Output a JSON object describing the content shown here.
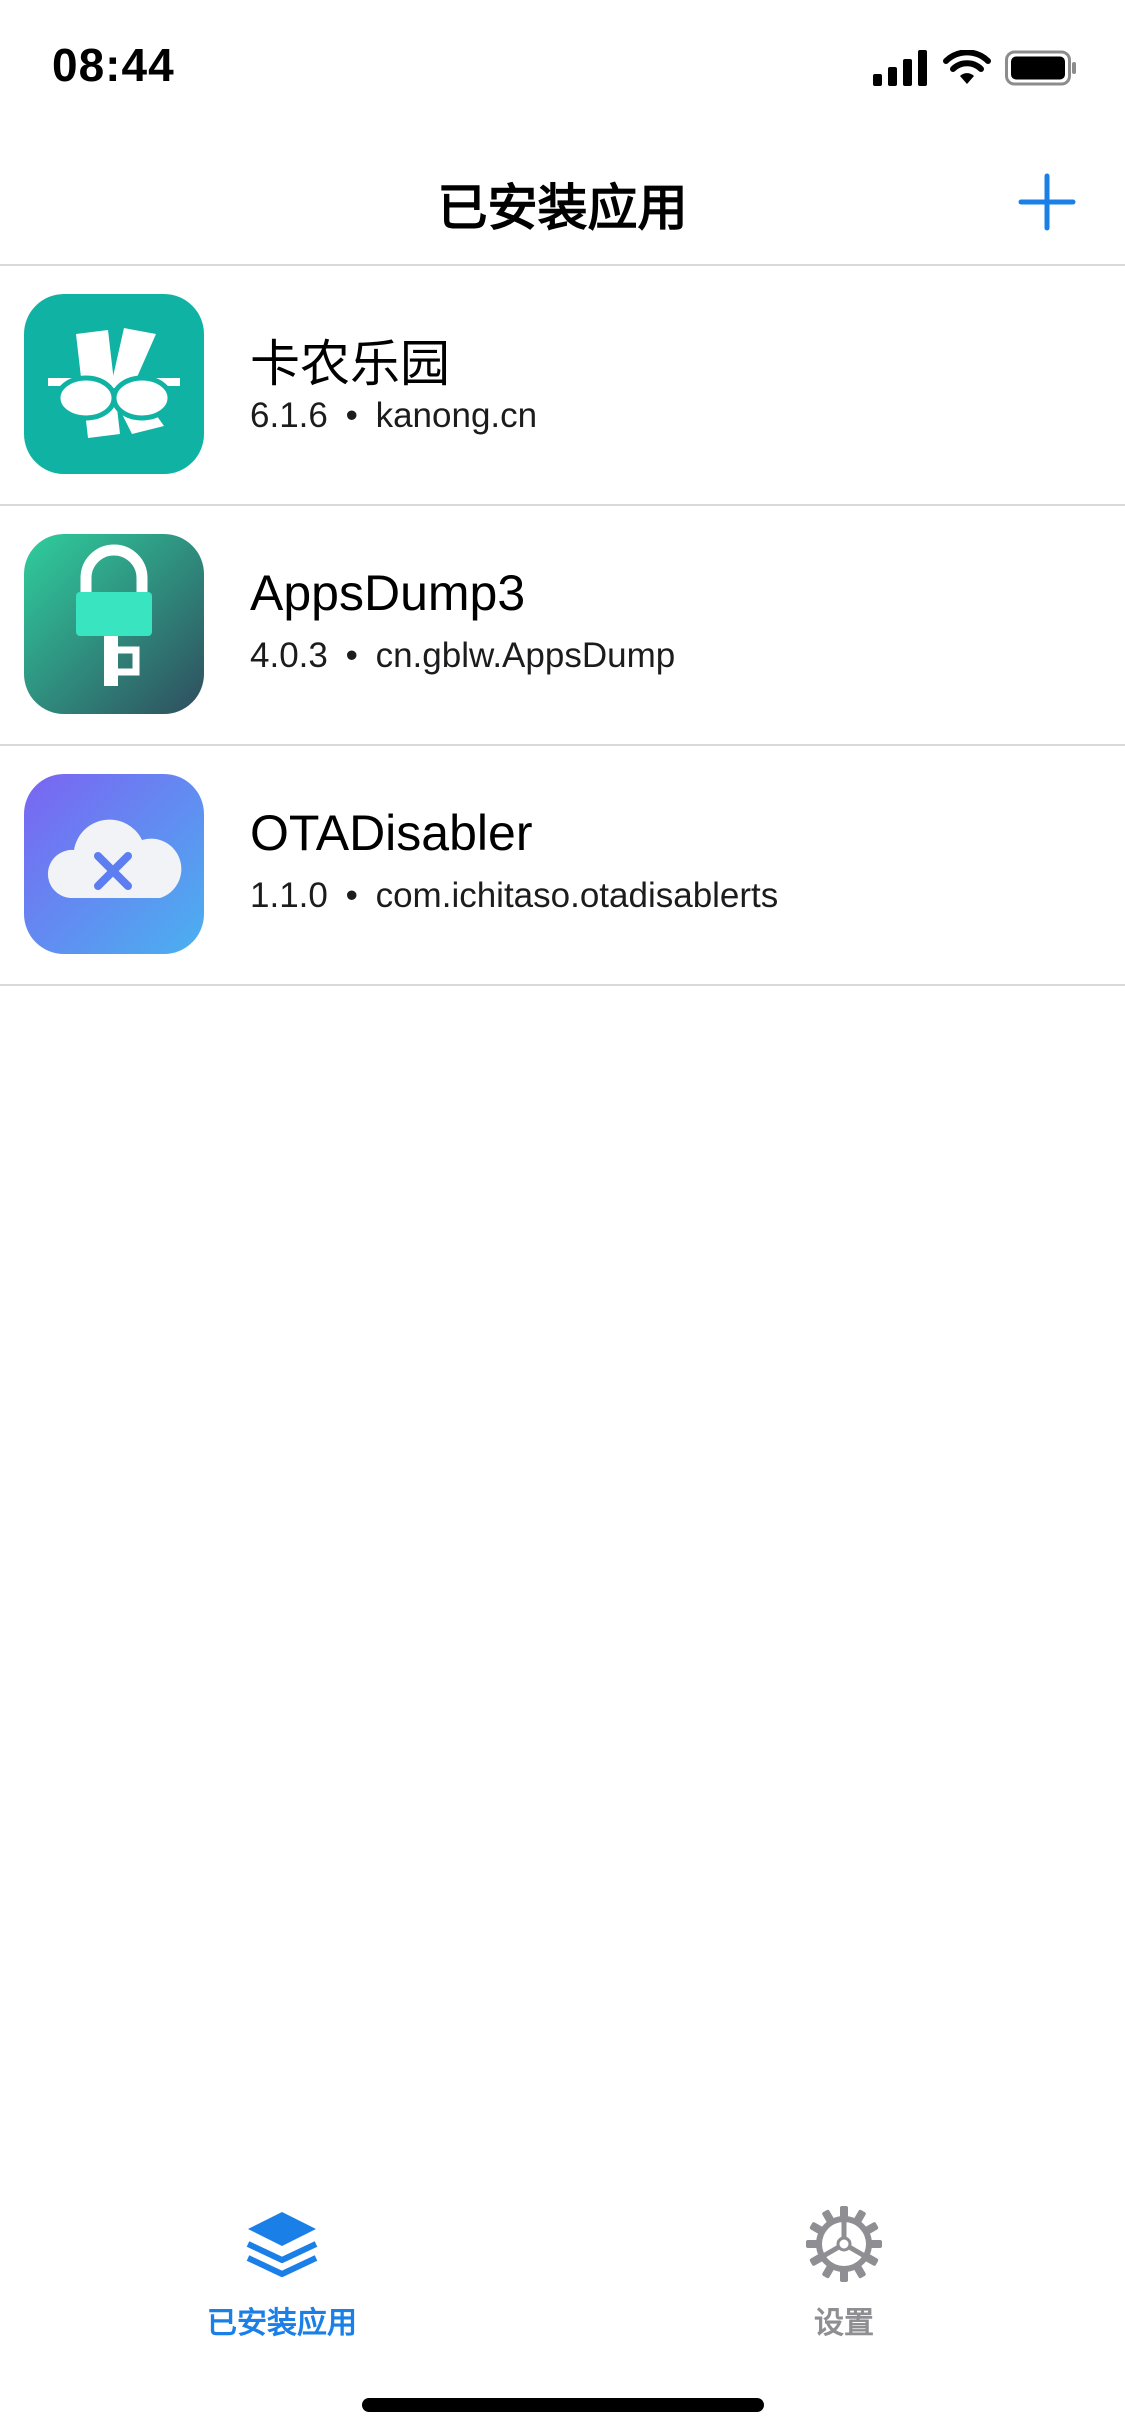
{
  "status_bar": {
    "time": "08:44",
    "icons": [
      "cellular-signal-icon",
      "wifi-icon",
      "battery-icon"
    ]
  },
  "nav": {
    "title": "已安装应用",
    "add_icon": "plus-icon"
  },
  "colors": {
    "accent": "#1a7fe6",
    "inactive": "#8e8e93",
    "separator": "#d9d9dc"
  },
  "apps": [
    {
      "name": "卡农乐园",
      "version": "6.1.6",
      "separator": "•",
      "bundle": "kanong.cn",
      "icon": "kanong-app-icon"
    },
    {
      "name": "AppsDump3",
      "version": "4.0.3",
      "separator": "•",
      "bundle": "cn.gblw.AppsDump",
      "icon": "appsdump-app-icon"
    },
    {
      "name": "OTADisabler",
      "version": "1.1.0",
      "separator": "•",
      "bundle": "com.ichitaso.otadisablerts",
      "icon": "otadisabler-app-icon"
    }
  ],
  "tabs": [
    {
      "label": "已安装应用",
      "icon": "layers-icon",
      "active": true
    },
    {
      "label": "设置",
      "icon": "gear-icon",
      "active": false
    }
  ]
}
